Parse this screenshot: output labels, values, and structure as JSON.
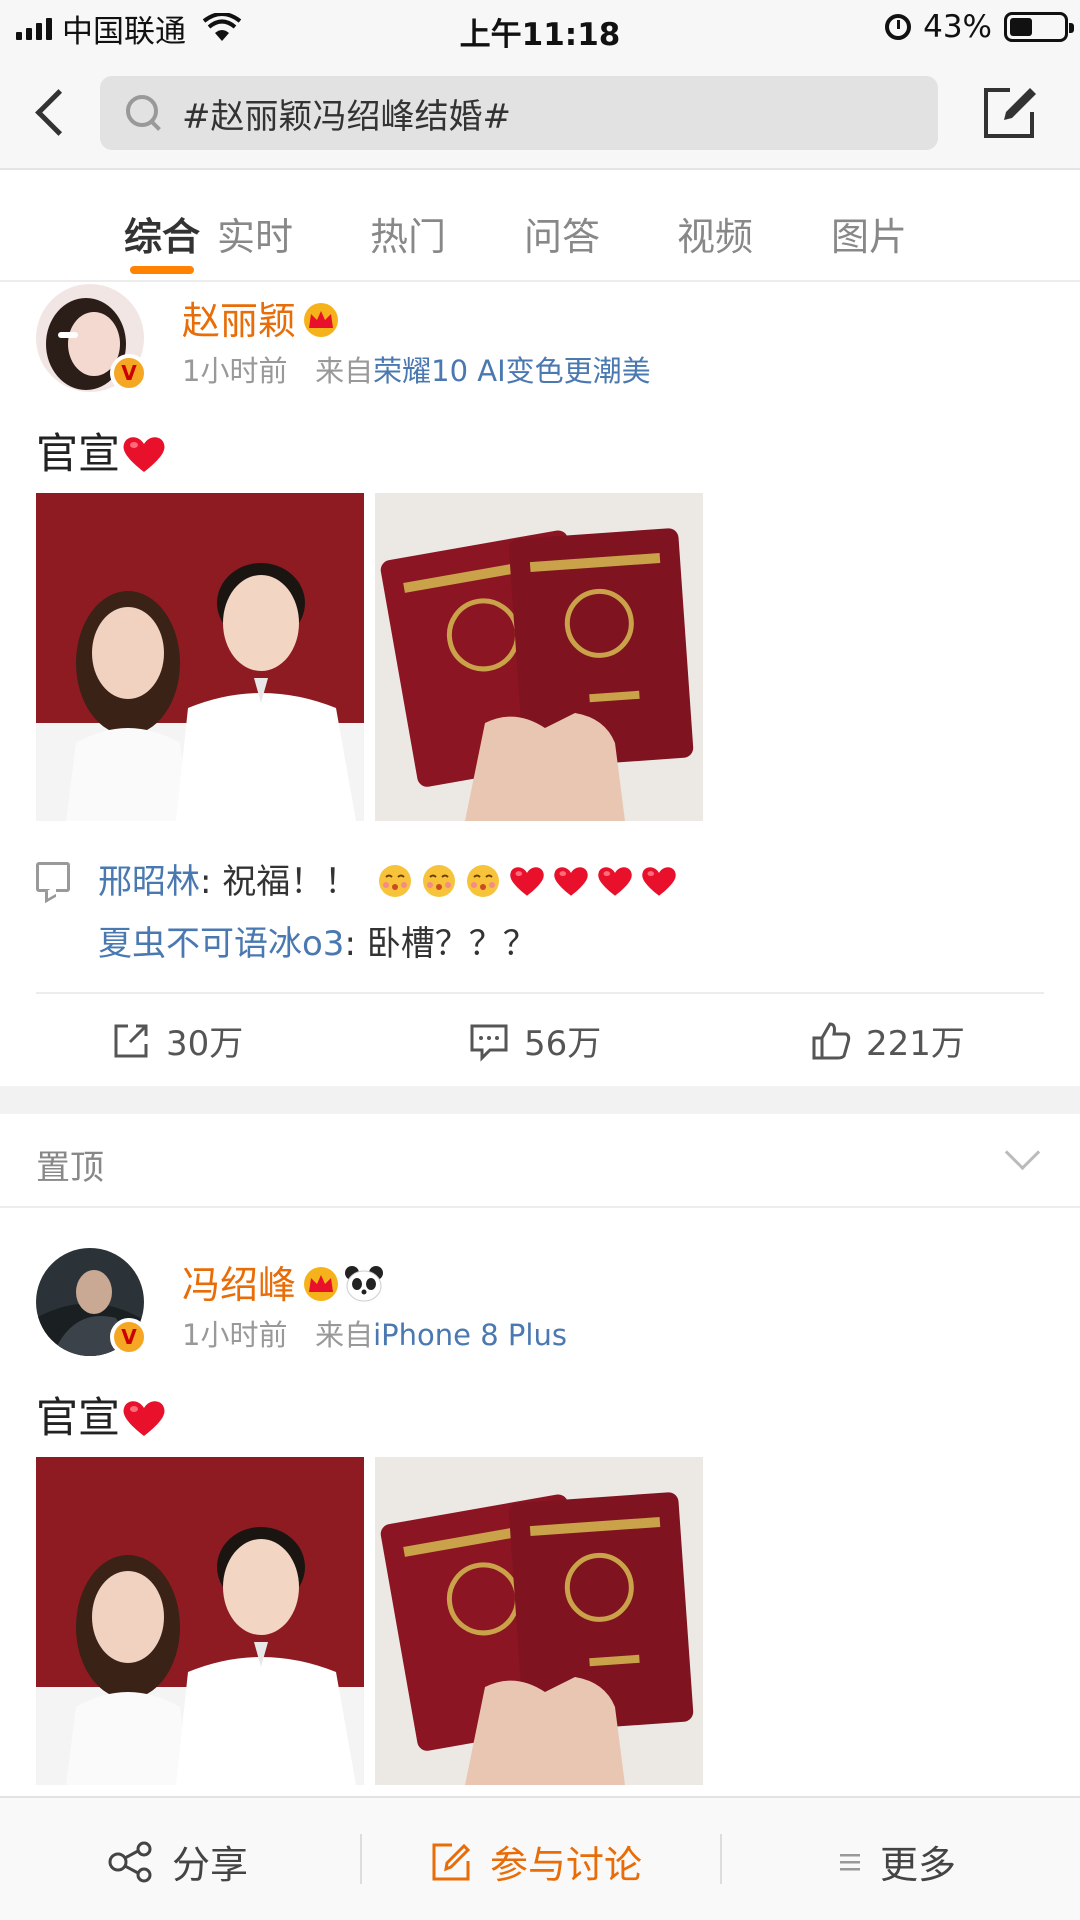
{
  "status_bar": {
    "carrier": "中国联通",
    "time": "上午11:18",
    "battery": "43%",
    "battery_level": 0.43
  },
  "search": {
    "value": "#赵丽颖冯绍峰结婚#"
  },
  "tabs": [
    {
      "label": "综合",
      "active": true
    },
    {
      "label": "实时"
    },
    {
      "label": "热门"
    },
    {
      "label": "问答"
    },
    {
      "label": "视频"
    },
    {
      "label": "图片"
    }
  ],
  "posts": [
    {
      "author": "赵丽颖",
      "time": "1小时前",
      "source_prefix": "来自",
      "source": "荣耀10 AI变色更潮美",
      "text": "官宣",
      "comments": [
        {
          "name": "邢昭林",
          "text": ": 祝福！！"
        },
        {
          "name": "夏虫不可语冰o3",
          "text": ": 卧槽？？？"
        }
      ],
      "reposts": "30万",
      "comment_count": "56万",
      "likes": "221万"
    },
    {
      "author": "冯绍峰",
      "time": "1小时前",
      "source_prefix": "来自",
      "source": "iPhone 8 Plus",
      "text": "官宣"
    }
  ],
  "pinned": {
    "label": "置顶"
  },
  "bottom_bar": {
    "share": "分享",
    "discuss": "参与讨论",
    "more": "更多"
  },
  "colors": {
    "accent": "#ff8200",
    "author": "#e86d08",
    "link": "#4a78b0",
    "cert_red": "#8b1522"
  }
}
